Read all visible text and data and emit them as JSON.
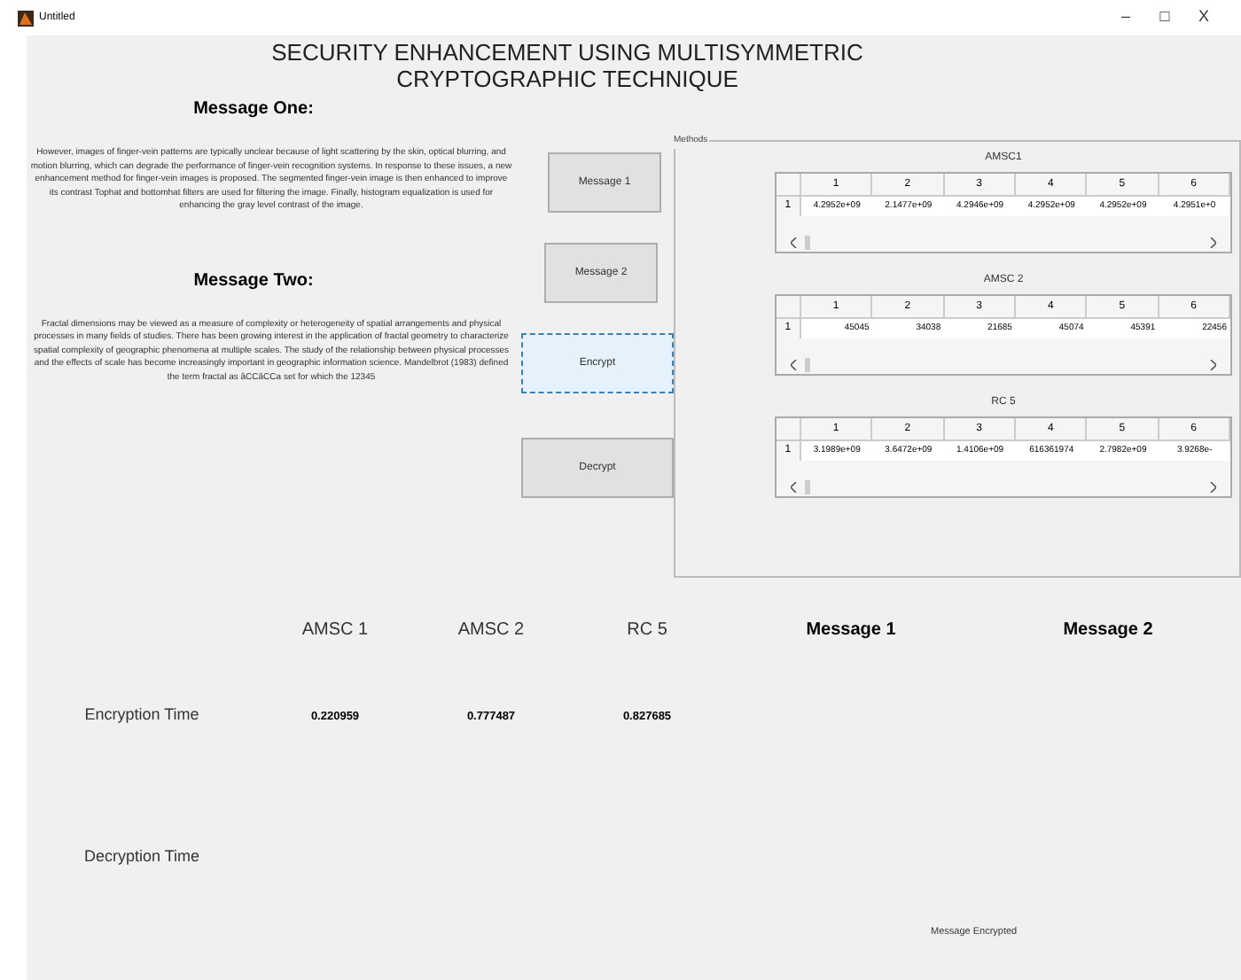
{
  "window": {
    "title": "Untitled",
    "controls": [
      "–",
      "□",
      "X"
    ]
  },
  "heading": "SECURITY ENHANCEMENT USING MULTISYMMETRIC CRYPTOGRAPHIC TECHNIQUE",
  "messages": [
    {
      "label": "Message One:",
      "text": "However, images of finger-vein patterns are typically unclear because of light scattering by the skin, optical blurring, and motion blurring, which can degrade the performance of finger-vein recognition systems. In response to these issues, a new enhancement method for finger-vein images is proposed. The segmented finger-vein image is then enhanced to improve its contrast Tophat and bottomhat filters are used for filtering the image. Finally, histogram equalization is used for enhancing the gray level contrast of the image."
    },
    {
      "label": "Message Two:",
      "text": "Fractal dimensions may be viewed as a measure of complexity or heterogeneity of spatial arrangements and physical processes in many fields of studies. There has been growing interest in the application of fractal geometry to characterize spatial complexity of geographic phenomena at multiple scales. The study of the relationship between physical processes and the effects of scale has become increasingly important in geographic information science. Mandelbrot (1983) defined the term fractal as âCCâCCa set for which the 12345"
    }
  ],
  "buttons": [
    {
      "label": "Message 1",
      "selected": false
    },
    {
      "label": "Message 2",
      "selected": false
    },
    {
      "label": "Encrypt",
      "selected": true
    },
    {
      "label": "Decrypt",
      "selected": false
    }
  ],
  "methods": {
    "label": "Methods",
    "tables": [
      {
        "title": "AMSC1",
        "columns": [
          "1",
          "2",
          "3",
          "4",
          "5",
          "6"
        ],
        "rows": [
          {
            "label": "1",
            "cells": [
              "4.2952e+09",
              "2.1477e+09",
              "4.2946e+09",
              "4.2952e+09",
              "4.2952e+09",
              "4.2951e+0"
            ]
          }
        ]
      },
      {
        "title": "AMSC 2",
        "columns": [
          "1",
          "2",
          "3",
          "4",
          "5",
          "6"
        ],
        "rows": [
          {
            "label": "1",
            "cells": [
              "45045",
              "34038",
              "21685",
              "45074",
              "45391",
              "22456"
            ]
          }
        ]
      },
      {
        "title": "RC 5",
        "columns": [
          "1",
          "2",
          "3",
          "4",
          "5",
          "6"
        ],
        "rows": [
          {
            "label": "1",
            "cells": [
              "3.1989e+09",
              "3.6472e+09",
              "1.4106e+09",
              "616361974",
              "2.7982e+09",
              "3.9268e-"
            ]
          }
        ]
      }
    ]
  },
  "results": {
    "columns": [
      "AMSC 1",
      "AMSC 2",
      "RC 5",
      "Message 1",
      "Message 2"
    ],
    "rows": [
      {
        "label": "Encryption Time",
        "values": [
          "0.220959",
          "0.777487",
          "0.827685"
        ]
      },
      {
        "label": "Decryption Time",
        "values": []
      }
    ],
    "status": "Message Encrypted"
  }
}
